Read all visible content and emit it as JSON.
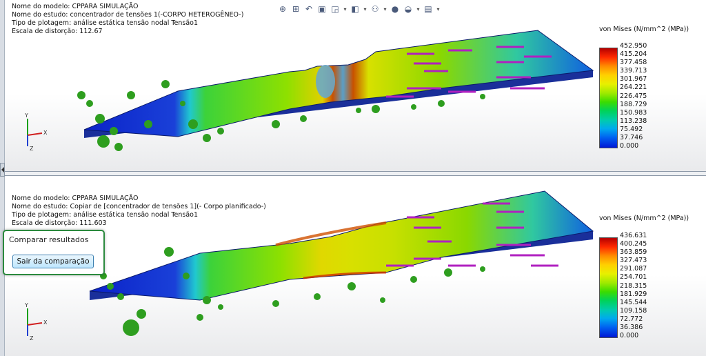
{
  "toolbar": {
    "icons": [
      "zoom-to-fit-icon",
      "zoom-area-icon",
      "previous-view-icon",
      "section-view-icon",
      "view-orientation-icon",
      "display-style-icon",
      "hide-show-icon",
      "edit-appearance-icon",
      "scene-icon",
      "view-settings-icon"
    ]
  },
  "top_view": {
    "model_name": "Nome do modelo: CPPARA SIMULAÇÃO",
    "study_name": "Nome do estudo: concentrador de tensões 1(-CORPO HETEROGÊNEO-)",
    "plot_type": "Tipo de plotagem: análise estática tensão nodal Tensão1",
    "deformation_scale": "Escala de distorção: 112.67",
    "legend_title": "von Mises (N/mm^2 (MPa))",
    "legend_values": [
      "452.950",
      "415.204",
      "377.458",
      "339.713",
      "301.967",
      "264.221",
      "226.475",
      "188.729",
      "150.983",
      "113.238",
      "75.492",
      "37.746",
      "0.000"
    ]
  },
  "bottom_view": {
    "model_name": "Nome do modelo: CPPARA SIMULAÇÃO",
    "study_name": "Nome do estudo: Copiar de [concentrador de tensões 1](- Corpo planificado-)",
    "plot_type": "Tipo de plotagem: análise estática tensão nodal Tensão1",
    "deformation_scale": "Escala de distorção: 111.603",
    "legend_title": "von Mises (N/mm^2 (MPa))",
    "legend_values": [
      "436.631",
      "400.245",
      "363.859",
      "327.473",
      "291.087",
      "254.701",
      "218.315",
      "181.929",
      "145.544",
      "109.158",
      "72.772",
      "36.386",
      "0.000"
    ]
  },
  "compare_dialog": {
    "title": "Comparar resultados",
    "exit_button": "Sair da comparação"
  },
  "axes": {
    "x": "X",
    "y": "Y",
    "z": "Z"
  },
  "colors": {
    "max_stress": "#b40000",
    "min_stress": "#0018d6",
    "fixture": "#2e9e1f",
    "load_arrow": "#b020c0",
    "dialog_border": "#2b8a3e"
  }
}
